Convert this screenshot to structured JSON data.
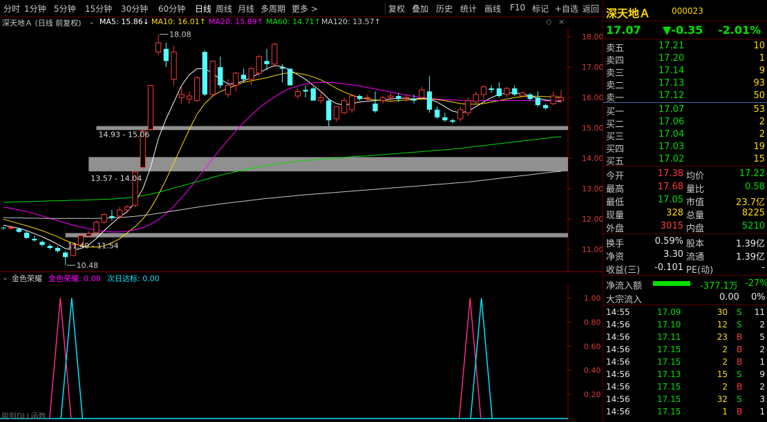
{
  "toolbar": {
    "tabs": [
      "分时",
      "1分钟",
      "5分钟",
      "15分钟",
      "30分钟",
      "60分钟",
      "日线",
      "周线",
      "月线",
      "多周期",
      "更多 >"
    ],
    "active": "日线",
    "right_buttons": [
      "复权",
      "叠加",
      "历史",
      "统计",
      "画线",
      "F10",
      "标记",
      "+自选",
      "返回"
    ]
  },
  "chart_header": {
    "title": "深天地Ａ (日线 前复权)",
    "ma5": "MA5: 15.86↓",
    "ma10": "MA10: 16.01↑",
    "ma20": "MA20: 15.89↑",
    "ma60": "MA60: 14.71↑",
    "ma120": "MA120: 13.57↑",
    "ma_colors": {
      "ma5": "#ffffff",
      "ma10": "#ffdc00",
      "ma20": "#ff00ff",
      "ma60": "#00e100",
      "ma120": "#c8c8c8"
    }
  },
  "annotations": {
    "high": "18.08",
    "low": "10.48",
    "zone1": "14.93 - 15.06",
    "zone2": "13.57 - 14.04",
    "zone3": "11.40 - 11.54"
  },
  "y_axis": [
    "18.00",
    "17.00",
    "16.00",
    "15.00",
    "14.00",
    "13.00",
    "12.00",
    "11.00"
  ],
  "sub_header": {
    "name": "金色荣耀",
    "v1": "金色荣耀: 0.00",
    "v2": "次日达标: 0.00"
  },
  "sub_axis": [
    "1.00",
    "0.80",
    "0.60",
    "0.40",
    "0.20"
  ],
  "bottom_note": "用到DLL函数",
  "stock": {
    "name": "深天地Ａ",
    "code": "000023",
    "price": "17.07",
    "change": "▼-0.35",
    "pct": "-2.01%"
  },
  "asks": [
    {
      "label": "卖五",
      "price": "17.21",
      "vol": "10"
    },
    {
      "label": "卖四",
      "price": "17.20",
      "vol": "1"
    },
    {
      "label": "卖三",
      "price": "17.14",
      "vol": "9"
    },
    {
      "label": "卖二",
      "price": "17.13",
      "vol": "93"
    },
    {
      "label": "卖一",
      "price": "17.12",
      "vol": "50"
    }
  ],
  "bids": [
    {
      "label": "买一",
      "price": "17.07",
      "vol": "53"
    },
    {
      "label": "买二",
      "price": "17.06",
      "vol": "2"
    },
    {
      "label": "买三",
      "price": "17.04",
      "vol": "2"
    },
    {
      "label": "买四",
      "price": "17.03",
      "vol": "19"
    },
    {
      "label": "买五",
      "price": "17.02",
      "vol": "15"
    }
  ],
  "stats": [
    {
      "l1": "今开",
      "v1": "17.38",
      "l2": "均价",
      "v2": "17.22"
    },
    {
      "l1": "最高",
      "v1": "17.68",
      "l2": "量比",
      "v2": "0.58"
    },
    {
      "l1": "最低",
      "v1": "17.05",
      "l2": "市值",
      "v2": "23.7亿"
    },
    {
      "l1": "现量",
      "v1": "328",
      "l2": "总量",
      "v2": "8225"
    },
    {
      "l1": "外盘",
      "v1": "3015",
      "l2": "内盘",
      "v2": "5210"
    }
  ],
  "stats2": [
    {
      "l1": "换手",
      "v1": "0.59%",
      "l2": "股本",
      "v2": "1.39亿"
    },
    {
      "l1": "净资",
      "v1": "3.30",
      "l2": "流通",
      "v2": "1.39亿"
    },
    {
      "l1": "收益(三)",
      "v1": "-0.101",
      "l2": "PE(动)",
      "v2": "-"
    }
  ],
  "flow": {
    "l1": "净流入额",
    "v1": "-377.1万",
    "p1": "-27%",
    "l2": "大宗流入",
    "v2": "0.00",
    "p2": "0%"
  },
  "ticks": [
    {
      "t": "14:55",
      "p": "17.09",
      "v": "30",
      "s": "S",
      "n": "11"
    },
    {
      "t": "14:56",
      "p": "17.10",
      "v": "12",
      "s": "S",
      "n": "2"
    },
    {
      "t": "14:56",
      "p": "17.11",
      "v": "23",
      "s": "B",
      "n": "5"
    },
    {
      "t": "14:56",
      "p": "17.15",
      "v": "2",
      "s": "B",
      "n": "2"
    },
    {
      "t": "14:56",
      "p": "17.15",
      "v": "2",
      "s": "B",
      "n": "1"
    },
    {
      "t": "14:56",
      "p": "17.13",
      "v": "15",
      "s": "S",
      "n": "9"
    },
    {
      "t": "14:56",
      "p": "17.15",
      "v": "2",
      "s": "B",
      "n": "2"
    },
    {
      "t": "14:56",
      "p": "17.15",
      "v": "32",
      "s": "S",
      "n": "3"
    },
    {
      "t": "14:56",
      "p": "17.15",
      "v": "1",
      "s": "B",
      "n": "1"
    }
  ],
  "chart_data": {
    "type": "candlestick",
    "ylim": [
      10.3,
      18.3
    ],
    "candles": [
      [
        11.72,
        11.75,
        11.65,
        11.7
      ],
      [
        11.7,
        11.78,
        11.65,
        11.72
      ],
      [
        11.68,
        11.7,
        11.55,
        11.58
      ],
      [
        11.55,
        11.6,
        11.35,
        11.38
      ],
      [
        11.35,
        11.45,
        11.25,
        11.3
      ],
      [
        11.25,
        11.3,
        11.1,
        11.15
      ],
      [
        11.12,
        11.18,
        11.0,
        11.05
      ],
      [
        11.05,
        11.1,
        10.9,
        10.95
      ],
      [
        10.9,
        10.95,
        10.48,
        10.75
      ],
      [
        10.8,
        11.2,
        10.8,
        11.15
      ],
      [
        11.15,
        11.5,
        11.1,
        11.45
      ],
      [
        11.45,
        11.6,
        11.4,
        11.52
      ],
      [
        11.55,
        11.95,
        11.5,
        11.9
      ],
      [
        11.9,
        12.2,
        11.85,
        12.15
      ],
      [
        12.1,
        12.3,
        11.95,
        12.05
      ],
      [
        12.1,
        12.4,
        12.0,
        12.3
      ],
      [
        12.3,
        12.45,
        12.2,
        12.4
      ],
      [
        12.45,
        13.6,
        12.4,
        13.55
      ],
      [
        13.7,
        14.95,
        13.6,
        14.9
      ],
      [
        14.95,
        16.4,
        14.9,
        16.4
      ],
      [
        17.5,
        18.08,
        17.4,
        17.8
      ],
      [
        17.6,
        17.8,
        17.0,
        17.2
      ],
      [
        16.6,
        17.7,
        16.4,
        17.5
      ],
      [
        16.0,
        16.4,
        15.8,
        16.1
      ],
      [
        15.95,
        16.2,
        15.8,
        16.05
      ],
      [
        15.9,
        16.7,
        15.85,
        16.65
      ],
      [
        17.5,
        17.55,
        16.05,
        16.1
      ],
      [
        16.1,
        17.2,
        16.0,
        17.2
      ],
      [
        17.0,
        17.35,
        16.3,
        16.4
      ],
      [
        16.1,
        16.6,
        16.0,
        16.4
      ],
      [
        16.4,
        16.85,
        16.2,
        16.8
      ],
      [
        16.75,
        16.95,
        16.5,
        16.6
      ],
      [
        16.6,
        17.0,
        16.4,
        16.95
      ],
      [
        16.8,
        17.4,
        16.7,
        17.35
      ],
      [
        17.2,
        17.6,
        16.9,
        17.1
      ],
      [
        17.1,
        17.8,
        17.0,
        17.75
      ],
      [
        17.0,
        17.1,
        16.5,
        16.95
      ],
      [
        16.95,
        16.95,
        16.4,
        16.4
      ],
      [
        16.05,
        16.3,
        15.95,
        16.2
      ],
      [
        16.25,
        16.4,
        16.0,
        16.2
      ],
      [
        16.3,
        16.35,
        15.9,
        15.9
      ],
      [
        15.9,
        16.2,
        15.8,
        16.0
      ],
      [
        15.9,
        15.95,
        15.05,
        15.25
      ],
      [
        15.3,
        15.7,
        15.2,
        15.7
      ],
      [
        15.5,
        16.0,
        15.45,
        15.9
      ],
      [
        15.6,
        16.1,
        15.5,
        16.05
      ],
      [
        16.05,
        16.1,
        15.9,
        15.95
      ],
      [
        16.0,
        16.1,
        15.85,
        16.0
      ],
      [
        15.8,
        16.2,
        15.5,
        15.55
      ],
      [
        15.9,
        16.05,
        15.8,
        16.0
      ],
      [
        16.0,
        16.15,
        15.85,
        16.05
      ],
      [
        16.05,
        16.15,
        15.85,
        15.95
      ],
      [
        16.0,
        16.1,
        15.85,
        16.0
      ],
      [
        15.95,
        16.1,
        15.8,
        15.9
      ],
      [
        16.0,
        16.35,
        15.9,
        16.25
      ],
      [
        16.2,
        16.7,
        15.5,
        15.6
      ],
      [
        15.6,
        15.7,
        15.3,
        15.35
      ],
      [
        15.35,
        15.5,
        15.2,
        15.25
      ],
      [
        15.25,
        15.3,
        15.15,
        15.2
      ],
      [
        15.3,
        15.7,
        15.2,
        15.6
      ],
      [
        15.5,
        16.0,
        15.4,
        15.9
      ],
      [
        15.85,
        16.2,
        15.8,
        16.1
      ],
      [
        16.1,
        16.4,
        15.95,
        16.35
      ],
      [
        16.3,
        16.4,
        16.15,
        16.25
      ],
      [
        16.3,
        16.5,
        16.0,
        16.05
      ],
      [
        16.1,
        16.35,
        16.0,
        16.3
      ],
      [
        16.3,
        16.4,
        16.05,
        16.1
      ],
      [
        16.05,
        16.2,
        16.0,
        16.15
      ],
      [
        16.1,
        16.15,
        15.9,
        15.95
      ],
      [
        16.0,
        16.2,
        15.7,
        15.75
      ],
      [
        15.75,
        15.8,
        15.6,
        15.65
      ],
      [
        15.8,
        16.2,
        15.75,
        16.05
      ],
      [
        15.9,
        16.25,
        15.85,
        16.0
      ]
    ],
    "ma_series": {
      "ma5": [
        11.8,
        11.75,
        11.7,
        11.62,
        11.52,
        11.42,
        11.3,
        11.17,
        11.03,
        10.98,
        11.03,
        11.15,
        11.36,
        11.62,
        11.85,
        12.07,
        12.25,
        12.55,
        13.0,
        13.7,
        14.65,
        15.3,
        15.85,
        16.4,
        16.75,
        16.95,
        16.95,
        16.8,
        16.6,
        16.45,
        16.45,
        16.55,
        16.65,
        16.8,
        16.95,
        17.05,
        17.02,
        16.9,
        16.75,
        16.6,
        16.4,
        16.2,
        15.95,
        15.8,
        15.75,
        15.8,
        15.85,
        15.88,
        15.9,
        15.92,
        15.95,
        15.98,
        15.97,
        15.95,
        15.98,
        15.95,
        15.85,
        15.7,
        15.55,
        15.5,
        15.55,
        15.7,
        15.85,
        16.0,
        16.1,
        16.15,
        16.15,
        16.12,
        16.05,
        15.98,
        15.92,
        15.9,
        15.86
      ],
      "ma10": [
        12.0,
        11.92,
        11.85,
        11.78,
        11.7,
        11.62,
        11.52,
        11.42,
        11.3,
        11.2,
        11.12,
        11.08,
        11.08,
        11.12,
        11.22,
        11.35,
        11.55,
        11.75,
        12.0,
        12.35,
        12.8,
        13.3,
        13.85,
        14.4,
        14.95,
        15.45,
        15.8,
        16.05,
        16.2,
        16.3,
        16.4,
        16.5,
        16.55,
        16.6,
        16.65,
        16.72,
        16.78,
        16.82,
        16.8,
        16.75,
        16.68,
        16.58,
        16.45,
        16.3,
        16.18,
        16.08,
        16.0,
        15.95,
        15.92,
        15.9,
        15.88,
        15.9,
        15.92,
        15.93,
        15.95,
        15.95,
        15.93,
        15.9,
        15.85,
        15.8,
        15.78,
        15.78,
        15.8,
        15.85,
        15.9,
        15.95,
        16.0,
        16.03,
        16.05,
        16.04,
        16.03,
        16.02,
        16.01
      ],
      "ma20": [
        12.4,
        12.35,
        12.3,
        12.25,
        12.18,
        12.1,
        12.02,
        11.95,
        11.87,
        11.8,
        11.74,
        11.68,
        11.63,
        11.6,
        11.58,
        11.58,
        11.6,
        11.65,
        11.72,
        11.83,
        11.98,
        12.18,
        12.42,
        12.7,
        13.0,
        13.32,
        13.65,
        13.98,
        14.3,
        14.6,
        14.9,
        15.18,
        15.42,
        15.65,
        15.85,
        16.02,
        16.18,
        16.3,
        16.38,
        16.45,
        16.48,
        16.5,
        16.5,
        16.48,
        16.45,
        16.42,
        16.38,
        16.33,
        16.28,
        16.23,
        16.18,
        16.13,
        16.08,
        16.04,
        16.0,
        15.97,
        15.95,
        15.93,
        15.92,
        15.91,
        15.9,
        15.9,
        15.9,
        15.9,
        15.9,
        15.9,
        15.9,
        15.9,
        15.9,
        15.89,
        15.89,
        15.89,
        15.89
      ],
      "ma60": [
        12.55,
        12.56,
        12.57,
        12.58,
        12.58,
        12.59,
        12.6,
        12.6,
        12.61,
        12.62,
        12.62,
        12.63,
        12.64,
        12.65,
        12.66,
        12.68,
        12.7,
        12.73,
        12.77,
        12.82,
        12.88,
        12.95,
        13.02,
        13.09,
        13.16,
        13.23,
        13.3,
        13.37,
        13.44,
        13.5,
        13.56,
        13.62,
        13.67,
        13.72,
        13.76,
        13.8,
        13.84,
        13.87,
        13.9,
        13.93,
        13.95,
        13.97,
        13.99,
        14.01,
        14.03,
        14.05,
        14.07,
        14.08,
        14.1,
        14.12,
        14.14,
        14.16,
        14.18,
        14.2,
        14.22,
        14.24,
        14.26,
        14.28,
        14.3,
        14.33,
        14.36,
        14.39,
        14.42,
        14.45,
        14.48,
        14.51,
        14.54,
        14.57,
        14.6,
        14.63,
        14.66,
        14.69,
        14.71
      ],
      "ma120": [
        12.05,
        12.04,
        12.04,
        12.03,
        12.03,
        12.02,
        12.02,
        12.02,
        12.02,
        12.02,
        12.02,
        12.02,
        12.02,
        12.03,
        12.04,
        12.05,
        12.07,
        12.09,
        12.12,
        12.15,
        12.19,
        12.23,
        12.27,
        12.31,
        12.35,
        12.39,
        12.43,
        12.46,
        12.5,
        12.53,
        12.56,
        12.59,
        12.62,
        12.65,
        12.68,
        12.7,
        12.73,
        12.75,
        12.78,
        12.8,
        12.82,
        12.84,
        12.86,
        12.88,
        12.9,
        12.92,
        12.94,
        12.96,
        12.98,
        13.0,
        13.02,
        13.04,
        13.06,
        13.08,
        13.1,
        13.12,
        13.14,
        13.16,
        13.18,
        13.2,
        13.22,
        13.25,
        13.28,
        13.31,
        13.34,
        13.37,
        13.4,
        13.43,
        13.46,
        13.49,
        13.52,
        13.55,
        13.57
      ]
    },
    "zones": [
      {
        "low": 14.93,
        "high": 15.06,
        "start": 12
      },
      {
        "low": 13.57,
        "high": 14.04,
        "start": 11
      },
      {
        "low": 11.4,
        "high": 11.54,
        "start": 8
      }
    ],
    "indicator": {
      "ylim": [
        0,
        1.1
      ],
      "pink_spikes": [
        5,
        41
      ],
      "cyan_spikes": [
        6,
        42
      ],
      "count": 50
    }
  }
}
